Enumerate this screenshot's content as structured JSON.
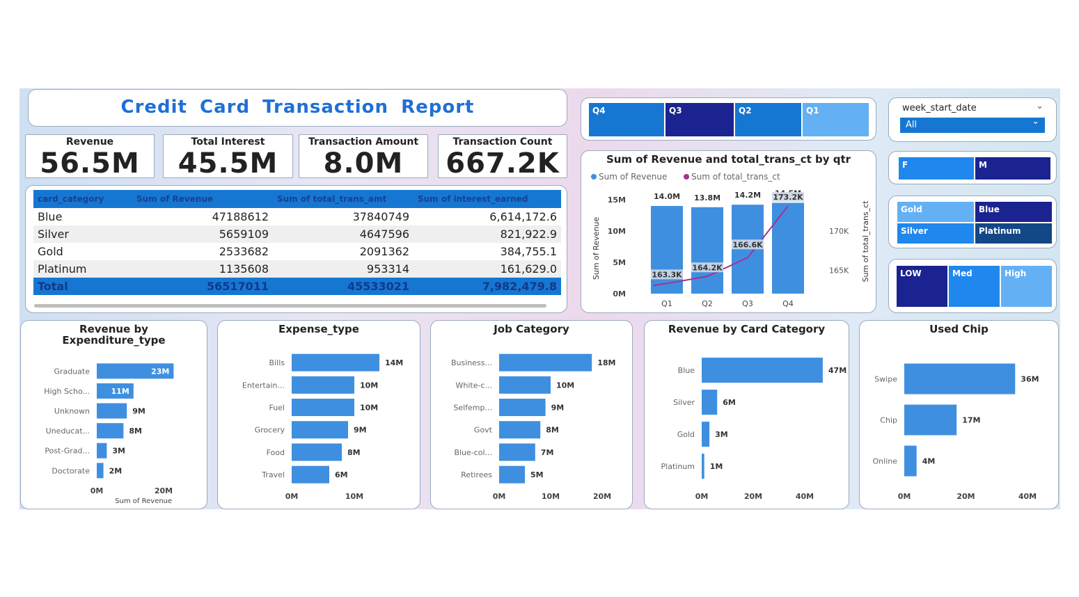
{
  "report_title": "Credit Card Transaction Report",
  "kpis": [
    {
      "label": "Revenue",
      "value": "56.5M"
    },
    {
      "label": "Total Interest",
      "value": "45.5M"
    },
    {
      "label": "Transaction Amount",
      "value": "8.0M"
    },
    {
      "label": "Transaction Count",
      "value": "667.2K"
    }
  ],
  "matrix": {
    "headers": [
      "card_category",
      "Sum of Revenue",
      "Sum of total_trans_amt",
      "Sum of interest_earned"
    ],
    "rows": [
      [
        "Blue",
        "47188612",
        "37840749",
        "6,614,172.6"
      ],
      [
        "Silver",
        "5659109",
        "4647596",
        "821,922.9"
      ],
      [
        "Gold",
        "2533682",
        "2091362",
        "384,755.1"
      ],
      [
        "Platinum",
        "1135608",
        "953314",
        "161,629.0"
      ]
    ],
    "total": [
      "Total",
      "56517011",
      "45533021",
      "7,982,479.8"
    ]
  },
  "quarter_slicer": [
    "Q4",
    "Q3",
    "Q2",
    "Q1"
  ],
  "week_slicer": {
    "label": "week_start_date",
    "value": "All"
  },
  "gender_slicer": [
    "F",
    "M"
  ],
  "card_slicer": [
    "Gold",
    "Blue",
    "Silver",
    "Platinum"
  ],
  "income_slicer": [
    "LOW",
    "Med",
    "High"
  ],
  "colors": {
    "bar": "#3f8fe0",
    "dark": "#1a238f",
    "mid": "#1677d2",
    "light": "#64b0f5",
    "line": "#a4338f",
    "navy": "#134786"
  },
  "chart_data": [
    {
      "type": "bar+line",
      "title": "Sum of Revenue and total_trans_ct by qtr",
      "legend": [
        "Sum of Revenue",
        "Sum of total_trans_ct"
      ],
      "categories": [
        "Q1",
        "Q2",
        "Q3",
        "Q4"
      ],
      "series": [
        {
          "name": "Sum of Revenue",
          "axis": "left",
          "values": [
            14.0,
            13.8,
            14.2,
            14.5
          ],
          "labels": [
            "14.0M",
            "13.8M",
            "14.2M",
            "14.5M"
          ]
        },
        {
          "name": "Sum of total_trans_ct",
          "axis": "right",
          "values": [
            163.3,
            164.2,
            166.6,
            173.2
          ],
          "labels": [
            "163.3K",
            "164.2K",
            "166.6K",
            "173.2K"
          ]
        }
      ],
      "ylabel": "Sum of Revenue",
      "y2label": "Sum of total_trans_ct",
      "yticks": [
        "0M",
        "5M",
        "10M",
        "15M"
      ],
      "y2ticks": [
        "165K",
        "170K"
      ],
      "ylim": [
        0,
        15
      ],
      "y2lim": [
        162,
        174
      ],
      "legend_position": "top-left"
    },
    {
      "type": "bar",
      "orientation": "horizontal",
      "title": "Revenue by Expenditure_type",
      "categories": [
        "Graduate",
        "High Scho...",
        "Unknown",
        "Uneducat...",
        "Post-Grad...",
        "Doctorate"
      ],
      "values": [
        23,
        11,
        9,
        8,
        3,
        2
      ],
      "labels": [
        "23M",
        "11M",
        "9M",
        "8M",
        "3M",
        "2M"
      ],
      "xticks": [
        "0M",
        "20M"
      ],
      "xlabel": "Sum of Revenue",
      "xlim": [
        0,
        40
      ]
    },
    {
      "type": "bar",
      "orientation": "horizontal",
      "title": "Expense_type",
      "categories": [
        "Bills",
        "Entertain...",
        "Fuel",
        "Grocery",
        "Food",
        "Travel"
      ],
      "values": [
        14,
        10,
        10,
        9,
        8,
        6
      ],
      "labels": [
        "14M",
        "10M",
        "10M",
        "9M",
        "8M",
        "6M"
      ],
      "xticks": [
        "0M",
        "10M"
      ],
      "xlim": [
        0,
        20
      ]
    },
    {
      "type": "bar",
      "orientation": "horizontal",
      "title": "Job Category",
      "categories": [
        "Business...",
        "White-c...",
        "Selfemp...",
        "Govt",
        "Blue-col...",
        "Retirees"
      ],
      "values": [
        18,
        10,
        9,
        8,
        7,
        5
      ],
      "labels": [
        "18M",
        "10M",
        "9M",
        "8M",
        "7M",
        "5M"
      ],
      "xticks": [
        "0M",
        "10M",
        "20M"
      ],
      "xlim": [
        0,
        20
      ]
    },
    {
      "type": "bar",
      "orientation": "horizontal",
      "title": "Revenue by Card Category",
      "categories": [
        "Blue",
        "Silver",
        "Gold",
        "Platinum"
      ],
      "values": [
        47,
        6,
        3,
        1
      ],
      "labels": [
        "47M",
        "6M",
        "3M",
        "1M"
      ],
      "xticks": [
        "0M",
        "20M",
        "40M"
      ],
      "xlim": [
        0,
        50
      ]
    },
    {
      "type": "bar",
      "orientation": "horizontal",
      "title": "Used Chip",
      "categories": [
        "Swipe",
        "Chip",
        "Online"
      ],
      "values": [
        36,
        17,
        4
      ],
      "labels": [
        "36M",
        "17M",
        "4M"
      ],
      "xticks": [
        "0M",
        "20M",
        "40M"
      ],
      "xlim": [
        0,
        40
      ]
    }
  ]
}
